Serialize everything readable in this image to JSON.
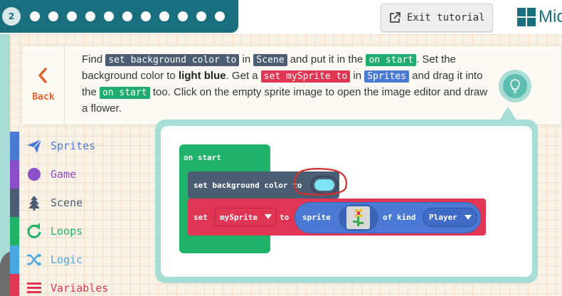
{
  "topbar": {
    "step_number": "2",
    "exit_label": "Exit tutorial",
    "brand_text": "Mic"
  },
  "colors": {
    "teal_dark": "#1a6f7e",
    "teal_light": "#a8ddd6",
    "block_start": "#21b26a",
    "block_scene": "#4b5d73",
    "block_sprites": "#e03553",
    "block_sprite_pill": "#4a7ad4",
    "light_blue": "#7ee3f2"
  },
  "instruction": {
    "back_label": "Back",
    "t1": "Find ",
    "tag_bg": "set background color to",
    "t2": " in ",
    "tag_scene": "Scene",
    "t3": " and put it in the ",
    "tag_start1": "on start",
    "t4": ". Set the background color to ",
    "bold_color": "light blue",
    "t5": ". Get a ",
    "tag_setsprite": "set mySprite to",
    "t6": " in ",
    "tag_sprites": "Sprites",
    "t7": " and drag it into the ",
    "tag_start2": "on start",
    "t8": " too. Click on the empty sprite image to open the image editor and draw a flower."
  },
  "toolbox": {
    "categories": [
      {
        "label": "Sprites",
        "icon": "paper-plane-icon",
        "color": "#4a7ad4"
      },
      {
        "label": "Game",
        "icon": "circle-icon",
        "color": "#8a4fc8"
      },
      {
        "label": "Scene",
        "icon": "tree-icon",
        "color": "#4b5d73"
      },
      {
        "label": "Loops",
        "icon": "refresh-icon",
        "color": "#21b26a"
      },
      {
        "label": "Logic",
        "icon": "shuffle-icon",
        "color": "#4aa8e0"
      },
      {
        "label": "Variables",
        "icon": "list-icon",
        "color": "#e03553"
      }
    ]
  },
  "blocks": {
    "on_start": "on start",
    "set_bg": "set background color to",
    "set": "set",
    "var_name": "mySprite",
    "to": "to",
    "sprite": "sprite",
    "of_kind": "of kind",
    "kind": "Player"
  }
}
